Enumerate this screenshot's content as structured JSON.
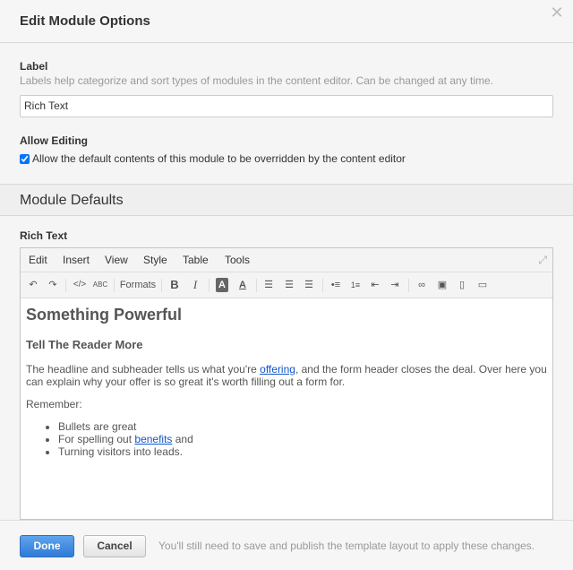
{
  "dialog": {
    "title": "Edit Module Options",
    "close_icon": "close-icon"
  },
  "label_field": {
    "label": "Label",
    "help": "Labels help categorize and sort types of modules in the content editor. Can be changed at any time.",
    "value": "Rich Text"
  },
  "allow_editing": {
    "label": "Allow Editing",
    "checkbox_label": "Allow the default contents of this module to be overridden by the content editor",
    "checked": true
  },
  "section": {
    "title": "Module Defaults"
  },
  "editor": {
    "label": "Rich Text",
    "menu": [
      "Edit",
      "Insert",
      "View",
      "Style",
      "Table",
      "Tools"
    ],
    "toolbar": {
      "formats_label": "Formats",
      "spellcheck_label": "ABC",
      "code_label": "</>",
      "bold_label": "B",
      "italic_label": "I",
      "bg_color_label": "A",
      "text_color_label": "A"
    },
    "content": {
      "heading1": "Something Powerful",
      "heading2": "Tell The Reader More",
      "para_before_link": "The headline and subheader tells us what you're ",
      "para_link": "offering",
      "para_after_link": ", and the form header closes the deal. Over here you can explain why your offer is so great it's worth filling out a form for.",
      "remember": "Remember:",
      "bullet1": "Bullets are great",
      "bullet2_before_link": "For spelling out ",
      "bullet2_link": "benefits",
      "bullet2_after_link": " and",
      "bullet3": "Turning visitors into leads."
    }
  },
  "footer": {
    "done_label": "Done",
    "cancel_label": "Cancel",
    "note": "You'll still need to save and publish the template layout to apply these changes."
  },
  "colors": {
    "accent": "#2f7ad6",
    "link": "#1155cc"
  }
}
